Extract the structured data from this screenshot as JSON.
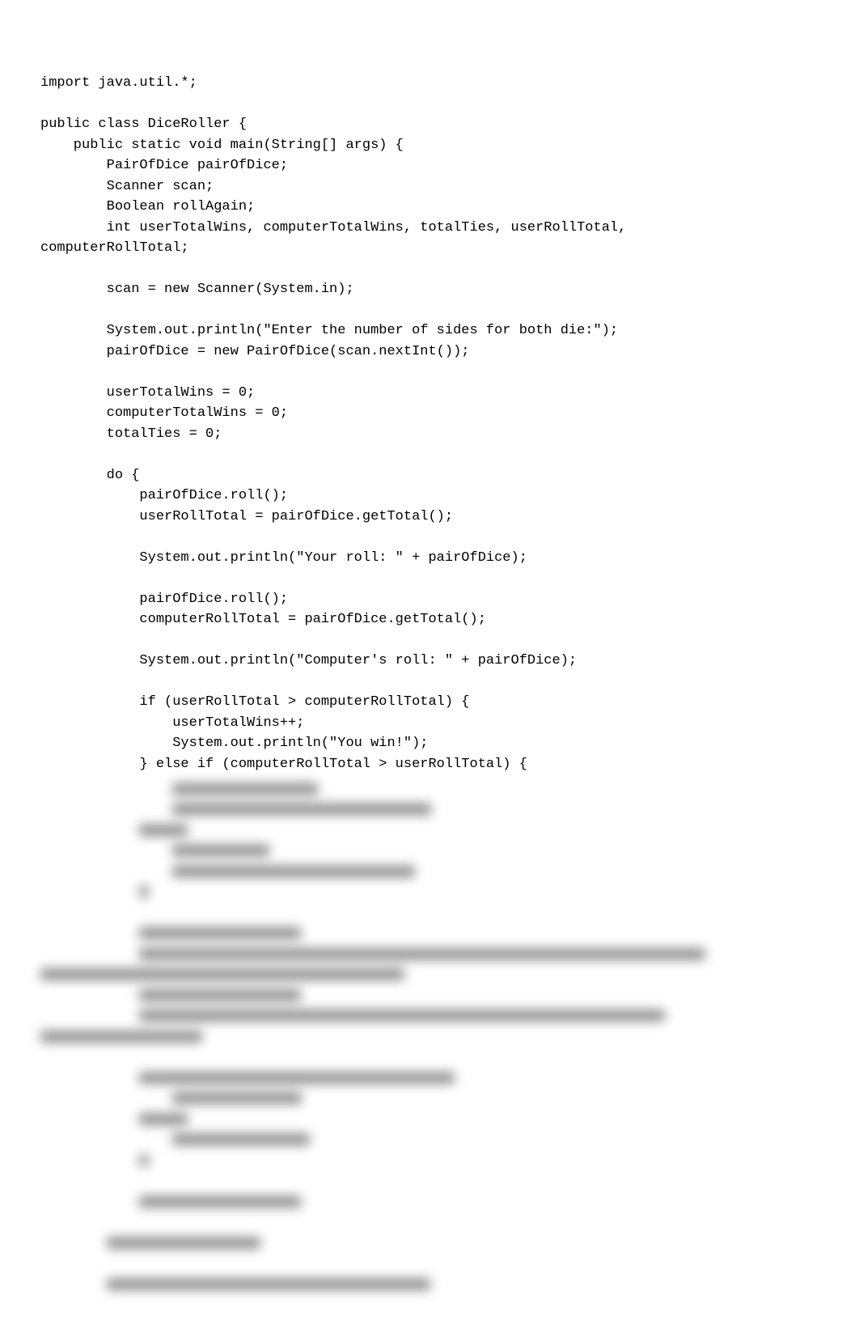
{
  "code": {
    "lines": [
      "import java.util.*;",
      "",
      "public class DiceRoller {",
      "    public static void main(String[] args) {",
      "        PairOfDice pairOfDice;",
      "        Scanner scan;",
      "        Boolean rollAgain;",
      "        int userTotalWins, computerTotalWins, totalTies, userRollTotal,",
      "computerRollTotal;",
      "",
      "        scan = new Scanner(System.in);",
      "",
      "        System.out.println(\"Enter the number of sides for both die:\");",
      "        pairOfDice = new PairOfDice(scan.nextInt());",
      "",
      "        userTotalWins = 0;",
      "        computerTotalWins = 0;",
      "        totalTies = 0;",
      "",
      "        do {",
      "            pairOfDice.roll();",
      "            userRollTotal = pairOfDice.getTotal();",
      "",
      "            System.out.println(\"Your roll: \" + pairOfDice);",
      "",
      "            pairOfDice.roll();",
      "            computerRollTotal = pairOfDice.getTotal();",
      "",
      "            System.out.println(\"Computer's roll: \" + pairOfDice);",
      "",
      "            if (userRollTotal > computerRollTotal) {",
      "                userTotalWins++;",
      "                System.out.println(\"You win!\");",
      "            } else if (computerRollTotal > userRollTotal) {"
    ]
  },
  "blurred": {
    "rows": [
      {
        "indent": 16,
        "segments": [
          180
        ]
      },
      {
        "indent": 16,
        "segments": [
          320
        ]
      },
      {
        "indent": 12,
        "segments": [
          60
        ]
      },
      {
        "indent": 16,
        "segments": [
          120
        ]
      },
      {
        "indent": 16,
        "segments": [
          300
        ]
      },
      {
        "indent": 12,
        "segments": [
          12
        ]
      },
      {
        "indent": 0,
        "segments": []
      },
      {
        "indent": 12,
        "segments": [
          200
        ]
      },
      {
        "indent": 12,
        "segments": [
          700
        ]
      },
      {
        "indent": 0,
        "segments": [
          450
        ]
      },
      {
        "indent": 12,
        "segments": [
          200
        ]
      },
      {
        "indent": 12,
        "segments": [
          650
        ]
      },
      {
        "indent": 0,
        "segments": [
          200
        ]
      },
      {
        "indent": 0,
        "segments": []
      },
      {
        "indent": 12,
        "segments": [
          390
        ]
      },
      {
        "indent": 16,
        "segments": [
          160
        ]
      },
      {
        "indent": 12,
        "segments": [
          60
        ]
      },
      {
        "indent": 16,
        "segments": [
          170
        ]
      },
      {
        "indent": 12,
        "segments": [
          12
        ]
      },
      {
        "indent": 0,
        "segments": []
      },
      {
        "indent": 12,
        "segments": [
          200
        ]
      },
      {
        "indent": 0,
        "segments": []
      },
      {
        "indent": 8,
        "segments": [
          190
        ]
      },
      {
        "indent": 0,
        "segments": []
      },
      {
        "indent": 8,
        "segments": [
          400
        ]
      }
    ]
  }
}
